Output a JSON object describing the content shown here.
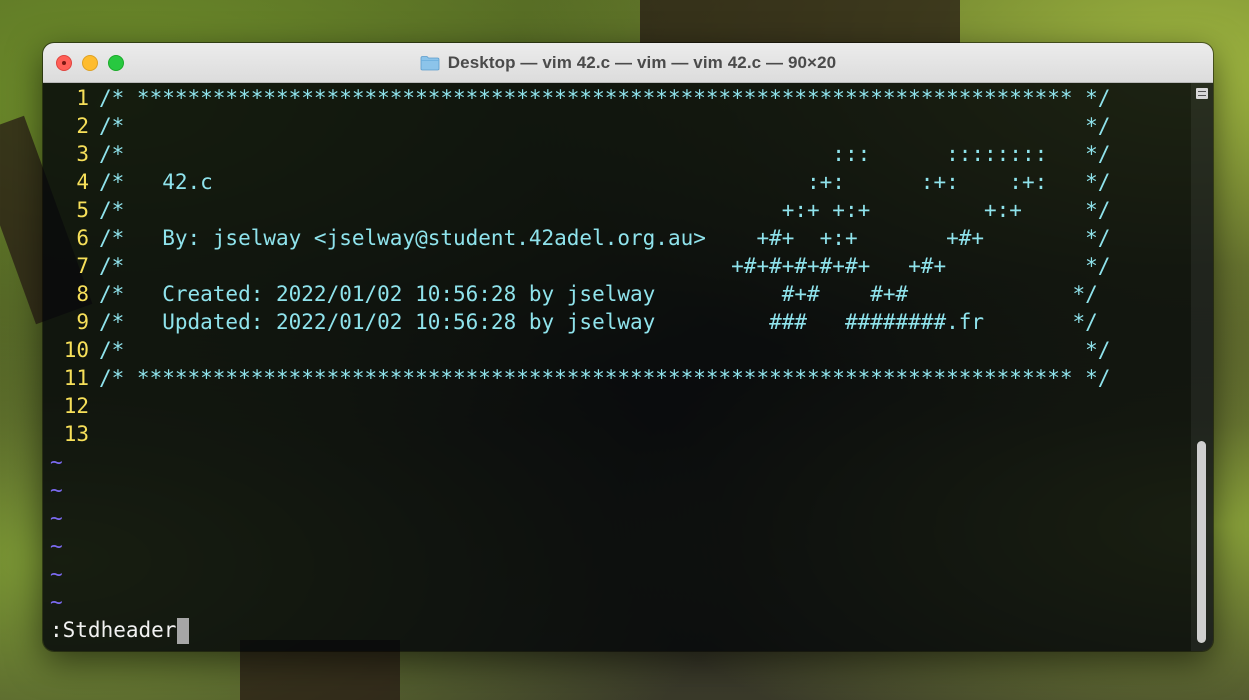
{
  "window": {
    "title": "Desktop — vim 42.c — vim — vim 42.c — 90×20",
    "title_icon": "folder-icon"
  },
  "editor": {
    "lines": [
      {
        "num": "1",
        "text": "/* ************************************************************************** */"
      },
      {
        "num": "2",
        "text": "/*                                                                            */"
      },
      {
        "num": "3",
        "text": "/*                                                        :::      ::::::::   */"
      },
      {
        "num": "4",
        "text": "/*   42.c                                               :+:      :+:    :+:   */"
      },
      {
        "num": "5",
        "text": "/*                                                    +:+ +:+         +:+     */"
      },
      {
        "num": "6",
        "text": "/*   By: jselway <jselway@student.42adel.org.au>    +#+  +:+       +#+        */"
      },
      {
        "num": "7",
        "text": "/*                                                +#+#+#+#+#+   +#+           */"
      },
      {
        "num": "8",
        "text": "/*   Created: 2022/01/02 10:56:28 by jselway          #+#    #+#             */"
      },
      {
        "num": "9",
        "text": "/*   Updated: 2022/01/02 10:56:28 by jselway         ###   ########.fr       */"
      },
      {
        "num": "10",
        "text": "/*                                                                            */"
      },
      {
        "num": "11",
        "text": "/* ************************************************************************** */"
      },
      {
        "num": "12",
        "text": ""
      },
      {
        "num": "13",
        "text": ""
      }
    ],
    "empty_line_marker": "~",
    "empty_line_count": 6,
    "command_line": ":Stdheader"
  },
  "colors": {
    "line_number": "#f7e05a",
    "code": "#8fe3ec",
    "tilde": "#7b6af0"
  }
}
